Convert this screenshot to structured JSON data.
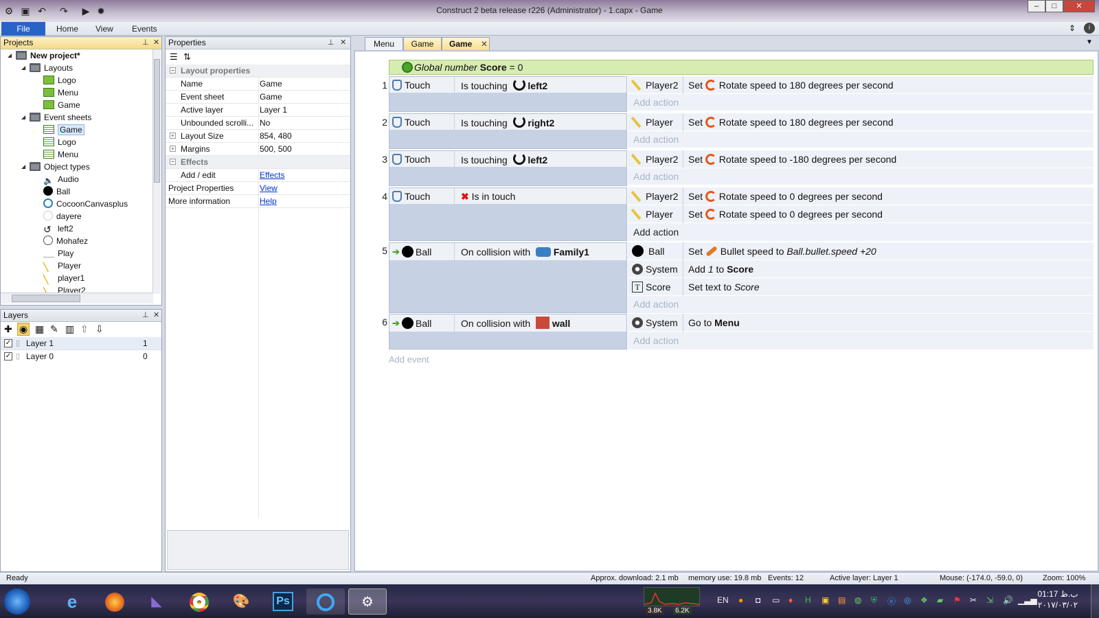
{
  "window": {
    "title": "Construct 2 beta release r226 (Administrator) - 1.capx - Game",
    "controls": {
      "minimize": "–",
      "maximize": "□",
      "close": "✕"
    }
  },
  "ribbon": {
    "file": "File",
    "home": "Home",
    "view": "View",
    "events": "Events"
  },
  "projects_panel": {
    "title": "Projects",
    "root": "New project*",
    "folders": {
      "layouts": "Layouts",
      "event_sheets": "Event sheets",
      "object_types": "Object types"
    },
    "layouts": [
      "Logo",
      "Menu",
      "Game"
    ],
    "event_sheets": [
      "Game",
      "Logo",
      "Menu"
    ],
    "object_types": [
      "Audio",
      "Ball",
      "CocoonCanvasplus",
      "dayere",
      "left2",
      "Mohafez",
      "Play",
      "Player",
      "player1",
      "Player2"
    ]
  },
  "layers_panel": {
    "title": "Layers",
    "layers": [
      {
        "name": "Layer 1",
        "index": "1"
      },
      {
        "name": "Layer 0",
        "index": "0"
      }
    ]
  },
  "properties_panel": {
    "title": "Properties",
    "category_layout": "Layout properties",
    "rows": [
      {
        "name": "Name",
        "value": "Game"
      },
      {
        "name": "Event sheet",
        "value": "Game"
      },
      {
        "name": "Active layer",
        "value": "Layer 1"
      },
      {
        "name": "Unbounded scrolli...",
        "value": "No"
      },
      {
        "name": "Layout Size",
        "value": "854, 480"
      },
      {
        "name": "Margins",
        "value": "500, 500"
      }
    ],
    "category_effects": "Effects",
    "effects_row": {
      "name": "Add / edit",
      "value": "Effects"
    },
    "project_properties": {
      "name": "Project Properties",
      "value": "View"
    },
    "more_information": {
      "name": "More information",
      "value": "Help"
    }
  },
  "doc_tabs": [
    "Menu",
    "Game",
    "Game"
  ],
  "event_sheet": {
    "global_var": {
      "prefix": "Global number",
      "name": "Score",
      "suffix": "= 0"
    },
    "add_event": "Add event",
    "add_action": "Add action",
    "events": [
      {
        "num": "1",
        "object": "Touch",
        "cond": "Is touching",
        "target": "left2",
        "actions": [
          {
            "object": "Player2",
            "verb": "Set",
            "text": "Rotate speed to 180 degrees per second"
          }
        ]
      },
      {
        "num": "2",
        "object": "Touch",
        "cond": "Is touching",
        "target": "right2",
        "actions": [
          {
            "object": "Player",
            "verb": "Set",
            "text": "Rotate speed to 180 degrees per second"
          }
        ]
      },
      {
        "num": "3",
        "object": "Touch",
        "cond": "Is touching",
        "target": "left2",
        "actions": [
          {
            "object": "Player2",
            "verb": "Set",
            "text": "Rotate speed to -180 degrees per second"
          }
        ]
      },
      {
        "num": "4",
        "object": "Touch",
        "cond": "Is in touch",
        "target": "",
        "actions": [
          {
            "object": "Player2",
            "verb": "Set",
            "text": "Rotate speed to 0 degrees per second"
          },
          {
            "object": "Player",
            "verb": "Set",
            "text": "Rotate speed to 0 degrees per second"
          }
        ]
      },
      {
        "num": "5",
        "object": "Ball",
        "cond": "On collision with",
        "target": "Family1",
        "actions": [
          {
            "object": "Ball",
            "verb": "Set",
            "text": "Bullet speed to",
            "expr": "Ball.bullet.speed +20"
          },
          {
            "object": "System",
            "verb": "Add",
            "num": "1",
            "mid": "to",
            "target": "Score"
          },
          {
            "object": "Score",
            "verb": "Set text to",
            "expr": "Score"
          }
        ]
      },
      {
        "num": "6",
        "object": "Ball",
        "cond": "On collision with",
        "target": "wall",
        "actions": [
          {
            "object": "System",
            "verb": "Go to",
            "target": "Menu"
          }
        ]
      }
    ]
  },
  "status_bar": {
    "ready": "Ready",
    "download": "Approx. download: 2.1 mb",
    "memory": "memory use: 19.8 mb",
    "events": "Events: 12",
    "active_layer": "Active layer: Layer 1",
    "mouse": "Mouse: (-174.0, -59.0, 0)",
    "zoom": "Zoom: 100%"
  },
  "taskbar": {
    "net_down": "3.8K",
    "net_up": "6.2K",
    "lang": "EN",
    "clock_time": "01:17 ب.ظ",
    "clock_date": "۲۰۱۷/۰۳/۰۲"
  }
}
